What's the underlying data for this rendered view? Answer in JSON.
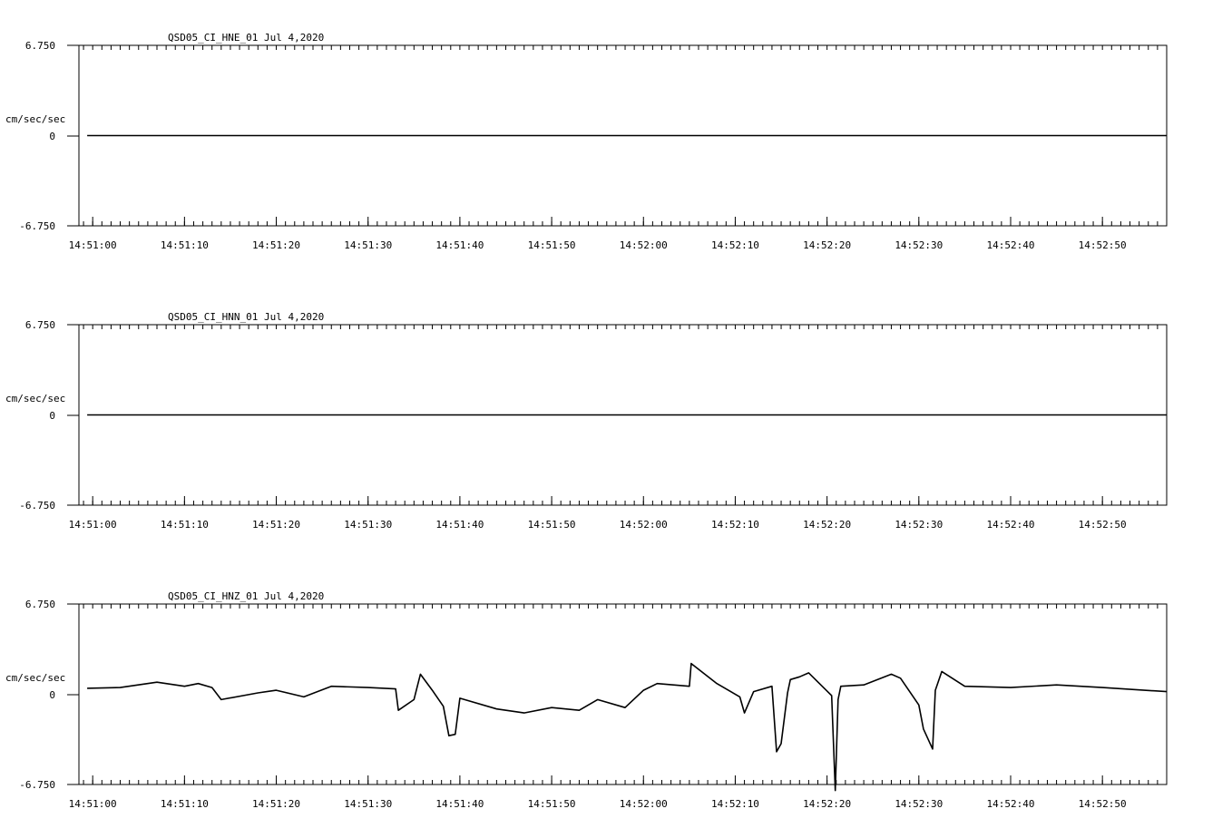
{
  "chart_data": [
    {
      "type": "line",
      "title": "QSD05_CI_HNE_01  Jul 4,2020",
      "ylabel": "cm/sec/sec",
      "ylim": [
        -6.75,
        6.75
      ],
      "y_tick_labels": [
        "6.750",
        "0",
        "-6.750"
      ],
      "x_tick_labels": [
        "14:51:00",
        "14:51:10",
        "14:51:20",
        "14:51:30",
        "14:51:40",
        "14:51:50",
        "14:52:00",
        "14:52:10",
        "14:52:20",
        "14:52:30",
        "14:52:40",
        "14:52:50"
      ],
      "xlim": [
        "14:50:58.5",
        "14:52:57"
      ],
      "series": [
        {
          "x": [
            "14:50:59.4",
            "14:52:57"
          ],
          "y": [
            0,
            0
          ]
        }
      ]
    },
    {
      "type": "line",
      "title": "QSD05_CI_HNN_01  Jul 4,2020",
      "ylabel": "cm/sec/sec",
      "ylim": [
        -6.75,
        6.75
      ],
      "y_tick_labels": [
        "6.750",
        "0",
        "-6.750"
      ],
      "x_tick_labels": [
        "14:51:00",
        "14:51:10",
        "14:51:20",
        "14:51:30",
        "14:51:40",
        "14:51:50",
        "14:52:00",
        "14:52:10",
        "14:52:20",
        "14:52:30",
        "14:52:40",
        "14:52:50"
      ],
      "xlim": [
        "14:50:58.5",
        "14:52:57"
      ],
      "series": [
        {
          "x": [
            "14:50:59.4",
            "14:52:57"
          ],
          "y": [
            0,
            0
          ]
        }
      ]
    },
    {
      "type": "line",
      "title": "QSD05_CI_HNZ_01  Jul 4,2020",
      "ylabel": "cm/sec/sec",
      "ylim": [
        -6.75,
        6.75
      ],
      "y_tick_labels": [
        "6.750",
        "0",
        "-6.750"
      ],
      "x_tick_labels": [
        "14:51:00",
        "14:51:10",
        "14:51:20",
        "14:51:30",
        "14:51:40",
        "14:51:50",
        "14:52:00",
        "14:52:10",
        "14:52:20",
        "14:52:30",
        "14:52:40",
        "14:52:50"
      ],
      "xlim": [
        "14:50:58.5",
        "14:52:57"
      ],
      "series": [
        {
          "x": [
            "14:50:59.4",
            "14:51:03",
            "14:51:07",
            "14:51:10",
            "14:51:11.5",
            "14:51:13",
            "14:51:14",
            "14:51:18",
            "14:51:20",
            "14:51:23",
            "14:51:26",
            "14:51:30",
            "14:51:33",
            "14:51:33.3",
            "14:51:35",
            "14:51:35.7",
            "14:51:37",
            "14:51:38.2",
            "14:51:38.8",
            "14:51:39.5",
            "14:51:40",
            "14:51:44",
            "14:51:47",
            "14:51:50",
            "14:51:53",
            "14:51:55",
            "14:51:58",
            "14:52:00",
            "14:52:01.5",
            "14:52:05",
            "14:52:05.2",
            "14:52:08",
            "14:52:10.5",
            "14:52:11",
            "14:52:12",
            "14:52:14",
            "14:52:14.5",
            "14:52:15",
            "14:52:15.7",
            "14:52:16",
            "14:52:17",
            "14:52:18",
            "14:52:20.5",
            "14:52:20.9",
            "14:52:21.2",
            "14:52:21.5",
            "14:52:24",
            "14:52:27",
            "14:52:28",
            "14:52:30",
            "14:52:30.5",
            "14:52:31.5",
            "14:52:31.8",
            "14:52:32.5",
            "14:52:35",
            "14:52:40",
            "14:52:45",
            "14:52:50",
            "14:52:57"
          ],
          "y": [
            0.45,
            0.5,
            0.9,
            0.6,
            0.8,
            0.5,
            -0.4,
            0.1,
            0.3,
            -0.2,
            0.6,
            0.5,
            0.4,
            -1.2,
            -0.4,
            1.5,
            0.3,
            -0.9,
            -3.1,
            -3.0,
            -0.3,
            -1.1,
            -1.4,
            -1.0,
            -1.2,
            -0.4,
            -1.0,
            0.3,
            0.8,
            0.6,
            2.3,
            0.8,
            -0.2,
            -1.4,
            0.2,
            0.6,
            -4.3,
            -3.7,
            0.1,
            1.1,
            1.3,
            1.6,
            -0.1,
            -7.2,
            -0.4,
            0.6,
            0.7,
            1.5,
            1.2,
            -0.8,
            -2.6,
            -4.1,
            0.3,
            1.7,
            0.6,
            0.5,
            0.7,
            0.5,
            0.2
          ]
        }
      ]
    }
  ]
}
